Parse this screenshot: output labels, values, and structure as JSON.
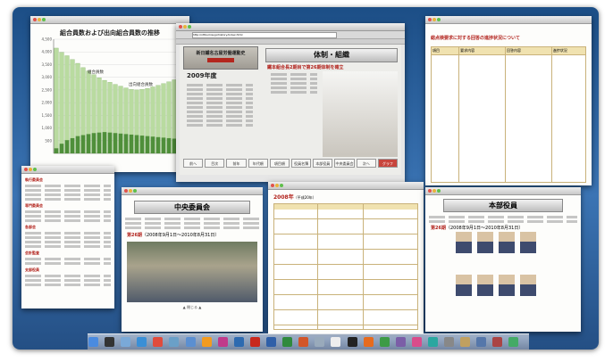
{
  "windows": {
    "chart_window": {
      "title": "組合員数および出向組合員数の推移",
      "label_kumiai": "組合員数",
      "label_shukko": "出向組合員数",
      "yticks": [
        "4,500",
        "4,000",
        "3,500",
        "3,000",
        "2,500",
        "2,000",
        "1,500",
        "1,000",
        "500"
      ]
    },
    "browser": {
      "url": "http://nttkumiai.jp/history/index.html",
      "book_title": "新日鐵名古屋労働運動史",
      "year_heading": "2009年度",
      "section_heading": "体制・組織",
      "red_heading": "鐵本組合長2期目で第26期体制を確立",
      "nav_items": [
        "前へ",
        "目次",
        "前年",
        "年代順",
        "項目順",
        "役員名簿",
        "本部役員",
        "中央委員会",
        "次へ",
        "グラフ"
      ]
    },
    "right_doc": {
      "heading": "総点検要求に対する回答の進捗状況について",
      "columns": [
        "項目",
        "要求内容",
        "回答内容",
        "進捗状況"
      ]
    },
    "chuo": {
      "title": "中央委員会",
      "term": "第26期",
      "term_dates": "（2008年9月1日〜2010年8月31日）",
      "back_link": "▲ 閉じる ▲"
    },
    "year_doc": {
      "title": "2008年",
      "subtitle": "（平成20年）"
    },
    "honbu": {
      "title": "本部役員",
      "term": "第26期",
      "term_dates": "（2008年9月1日〜2010年8月31日）"
    },
    "left_list": {
      "sections": [
        "執行委員会",
        "専門委員会",
        "各部会",
        "会計監査",
        "支部役員"
      ]
    }
  },
  "chart_data": {
    "type": "bar",
    "title": "組合員数および出向組合員数の推移",
    "series": [
      {
        "name": "組合員数",
        "values": [
          4150,
          3980,
          3850,
          3700,
          3550,
          3380,
          3250,
          3100,
          2980,
          2880,
          2800,
          2720,
          2650,
          2580,
          2520,
          2500,
          2520,
          2560,
          2620,
          2680,
          2750,
          2820,
          2900,
          2980
        ]
      },
      {
        "name": "出向組合員数",
        "values": [
          200,
          380,
          520,
          600,
          680,
          720,
          760,
          800,
          820,
          840,
          820,
          800,
          780,
          760,
          740,
          720,
          700,
          680,
          660,
          640,
          620,
          600,
          580,
          560
        ]
      }
    ],
    "ylim": [
      0,
      4500
    ]
  }
}
